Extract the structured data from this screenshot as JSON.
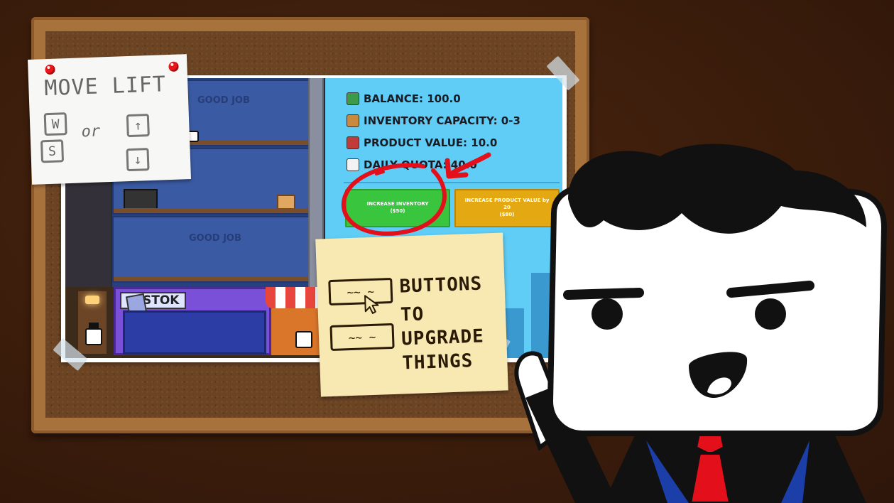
{
  "game_panel": {
    "balance": "BALANCE: 100.0",
    "inventory_capacity": "INVENTORY CAPACITY: 0-3",
    "product_value": "PRODUCT VALUE: 10.0",
    "daily_quota": "DAILY QUOTA: 40.0",
    "btn_increase_inventory": "INCREASE INVENTORY",
    "btn_increase_inventory_cost": "($50)",
    "btn_increase_product_value": "INCREASE PRODUCT VALUE by",
    "btn_increase_product_value_amount": "20",
    "btn_increase_product_value_cost": "($80)"
  },
  "building": {
    "stok_label": "STOK",
    "floor_doodle_1": "GOOD JOB",
    "floor_doodle_2": "GOOD JOB"
  },
  "note_move_lift": {
    "title": "MOVE LIFT",
    "key_w": "W",
    "key_s": "S",
    "or": "or",
    "key_up": "↑",
    "key_down": "↓"
  },
  "note_buttons": {
    "line1": "BUTTONS",
    "line2": "TO",
    "line3": "UPGRADE",
    "line4": "THINGS",
    "sketch_text": "~~ ~"
  },
  "colors": {
    "green_button": "#3ac53f",
    "gold_button": "#e4a912",
    "panel_bg": "#5fcdf5",
    "annotation_red": "#e3101c"
  }
}
